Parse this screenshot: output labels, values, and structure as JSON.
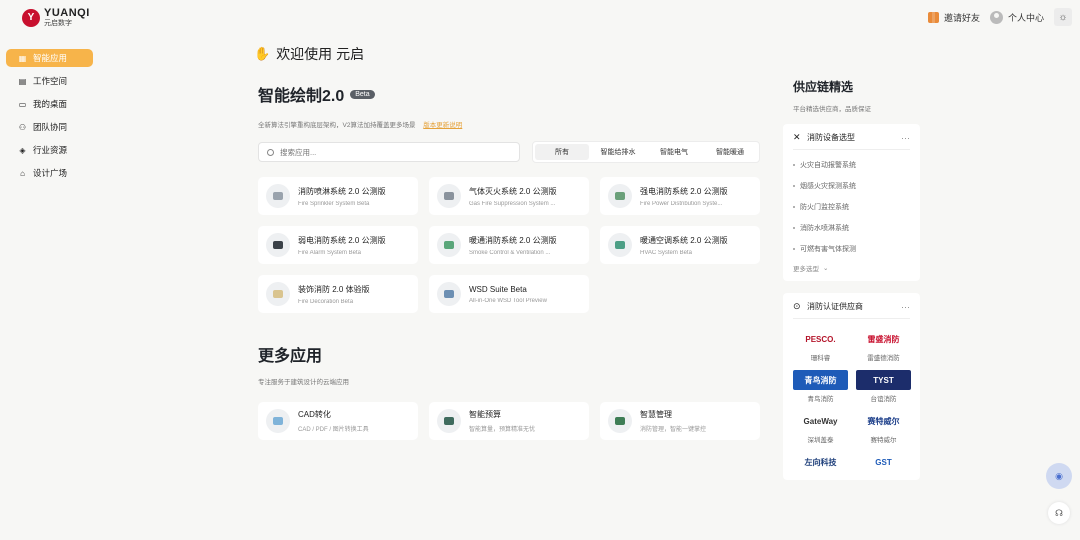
{
  "header": {
    "logo_en": "YUANQI",
    "logo_cn": "元启数字",
    "invite_label": "邀请好友",
    "profile_label": "个人中心"
  },
  "sidebar": {
    "items": [
      {
        "label": "智能应用",
        "icon": "grid-icon",
        "active": true
      },
      {
        "label": "工作空间",
        "icon": "workspace-icon",
        "active": false
      },
      {
        "label": "我的桌面",
        "icon": "monitor-icon",
        "active": false
      },
      {
        "label": "团队协同",
        "icon": "team-icon",
        "active": false
      },
      {
        "label": "行业资源",
        "icon": "graduation-cap-icon",
        "active": false
      },
      {
        "label": "设计广场",
        "icon": "bank-icon",
        "active": false
      }
    ]
  },
  "main": {
    "welcome": "欢迎使用 元启",
    "section1": {
      "title": "智能绘制2.0",
      "badge": "Beta",
      "desc": "全新算法引擎重构底层架构，V2算法加持覆盖更多场景",
      "link": "版本更新说明"
    },
    "search_placeholder": "搜索应用...",
    "filters": [
      "所有",
      "智能给排水",
      "智能电气",
      "智能暖通"
    ],
    "apps": [
      {
        "title": "消防喷淋系统 2.0 公测版",
        "sub": "Fire Sprinkler System Beta",
        "color": "#9aa3ad"
      },
      {
        "title": "气体灭火系统 2.0 公测版",
        "sub": "Gas Fire Suppression System ...",
        "color": "#8a939d"
      },
      {
        "title": "强电消防系统 2.0 公测版",
        "sub": "Fire Power Distribution Syste...",
        "color": "#6aa07a"
      },
      {
        "title": "弱电消防系统 2.0 公测版",
        "sub": "Fire Alarm System Beta",
        "color": "#3b4148"
      },
      {
        "title": "暖通消防系统 2.0 公测版",
        "sub": "Smoke Control & Ventilation ...",
        "color": "#5aa67a"
      },
      {
        "title": "暖通空调系统 2.0 公测版",
        "sub": "HVAC System Beta",
        "color": "#4d9f86"
      },
      {
        "title": "装饰消防 2.0 体验版",
        "sub": "Fire Decoration Beta",
        "color": "#d9c48f"
      },
      {
        "title": "WSD Suite Beta",
        "sub": "All-in-One WSD Tool Preview",
        "color": "#6c8fb3"
      }
    ],
    "section2": {
      "title": "更多应用",
      "desc": "专注服务于建筑设计的云端应用"
    },
    "more_apps": [
      {
        "title": "CAD转化",
        "sub": "CAD / PDF / 图片转换工具",
        "color": "#7fb3d9"
      },
      {
        "title": "智能预算",
        "sub": "智能算量，预算精准无忧",
        "color": "#3f6b5e"
      },
      {
        "title": "智慧管理",
        "sub": "消防管理，智能一键掌控",
        "color": "#3e7d56"
      }
    ]
  },
  "right": {
    "title": "供应链精选",
    "sub": "平台精选供应商，品质保证",
    "box1": {
      "title": "消防设备选型",
      "items": [
        "火灾自动报警系统",
        "烟感火灾探测系统",
        "防火门监控系统",
        "消防水喷淋系统",
        "可燃有害气体探测"
      ],
      "more": "更多选型"
    },
    "box2": {
      "title": "消防认证供应商",
      "suppliers": [
        {
          "logo": "PESCO.",
          "name": "珊科睿",
          "bg": "#ffffff",
          "fg": "#b4142a"
        },
        {
          "logo": "雷盛消防",
          "name": "雷盛德消防",
          "bg": "#ffffff",
          "fg": "#c8102e"
        },
        {
          "logo": "青鸟消防",
          "name": "青鸟消防",
          "bg": "#1e5bb8",
          "fg": "#ffffff"
        },
        {
          "logo": "TYST",
          "name": "台谊消防",
          "bg": "#1c2d6b",
          "fg": "#ffffff"
        },
        {
          "logo": "GateWay",
          "name": "深圳盖泰",
          "bg": "#ffffff",
          "fg": "#333333"
        },
        {
          "logo": "赛特威尔",
          "name": "赛特威尔",
          "bg": "#ffffff",
          "fg": "#1d3f8a"
        },
        {
          "logo": "左向科技",
          "name": "",
          "bg": "#ffffff",
          "fg": "#1e3f7a"
        },
        {
          "logo": "GST",
          "name": "",
          "bg": "#ffffff",
          "fg": "#1e5bb8"
        }
      ]
    }
  }
}
